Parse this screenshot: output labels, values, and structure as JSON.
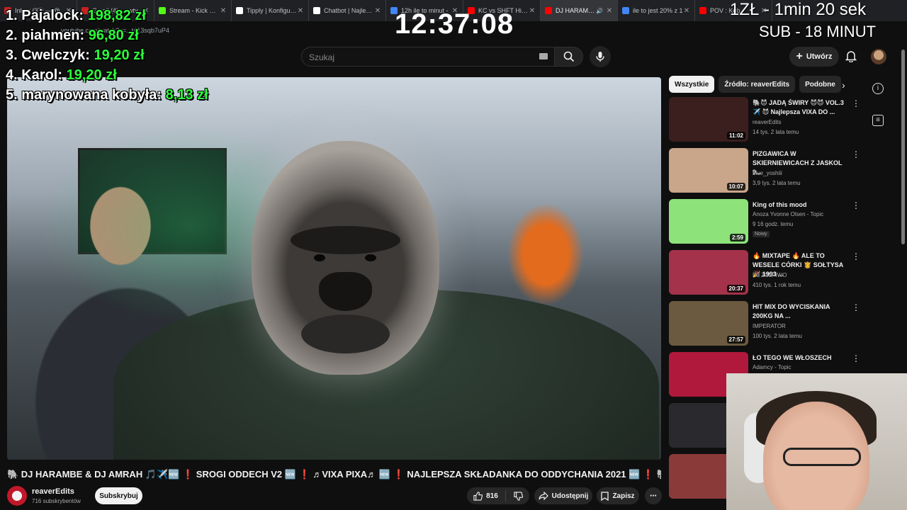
{
  "browser": {
    "tabs": [
      {
        "label": "Inbox (37) — @",
        "color": "#c5221f",
        "active": false
      },
      {
        "label": "Gmail (4) — wtv",
        "color": "#c5221f",
        "active": false
      },
      {
        "label": "Stream - Kick Das",
        "color": "#53fc18",
        "active": false
      },
      {
        "label": "Tipply | Konfigurat",
        "color": "#ffffff",
        "active": false
      },
      {
        "label": "Chatbot | Najlepsz",
        "color": "#ffffff",
        "active": false
      },
      {
        "label": "12h ile to minut -",
        "color": "#4285f4",
        "active": false
      },
      {
        "label": "KC vs SHFT Highli",
        "color": "#ff0000",
        "active": false
      },
      {
        "label": "DJ HARAMBE",
        "color": "#ff0000",
        "active": true
      },
      {
        "label": "ile to jest 20% z 1",
        "color": "#4285f4",
        "active": false
      },
      {
        "label": "POV : Keb",
        "color": "#ff0000",
        "active": false
      }
    ],
    "address": "youtube.com/watch?v=...t413sqb7uP4"
  },
  "overlay": {
    "donors": [
      {
        "name": "1. Pajalock:",
        "amount": "198,82 zł"
      },
      {
        "name": "2. piahmen:",
        "amount": "96,80 zł"
      },
      {
        "name": "3. Cwelczyk:",
        "amount": "19,20 zł"
      },
      {
        "name": "4. Karol:",
        "amount": "19,20 zł"
      },
      {
        "name": "5. marynowana kobyła:",
        "amount": "8,13 zł"
      }
    ],
    "clock": "12:37:08",
    "promo_line1": "1ZŁ - 1min 20 sek",
    "promo_line2": "SUB - 18 MINUT"
  },
  "youtube": {
    "search_placeholder": "Szukaj",
    "create_label": "Utwórz",
    "video": {
      "title": "🐘 DJ HARAMBE & DJ AMRAH 🎵✈️🆕 ❗ SROGI ODDECH V2 🆕 ❗ ♬VIXA PIXA♬ 🆕 ❗ NAJLEPSZA SKŁADANKA DO ODDYCHANIA 2021 🆕 ❗ 🐘",
      "channel": "reaverEdits",
      "subscribers": "716 subskrybentów",
      "subscribe_label": "Subskrybuj",
      "likes": "816",
      "share_label": "Udostępnij",
      "save_label": "Zapisz"
    },
    "chips": [
      "Wszystkie",
      "Źródło: reaverEdits",
      "Podobne"
    ],
    "recommendations": [
      {
        "title": "🐘😈 JADĄ ŚWIRY 😈😈 VOL.3 ✈️ 😈 Najlepsza VIXA DO ...",
        "channel": "reaverEdits",
        "meta": "14 tys.  2 lata temu",
        "duration": "11:02",
        "badge": "",
        "thumb": "#3b1e1e"
      },
      {
        "title": "PIZGAWICA W SKIERNIEWICACH Z JASKOL 9...",
        "channel": "blue_yoshiii",
        "meta": "3,9 tys.  2 lata temu",
        "duration": "10:07",
        "badge": "",
        "thumb": "#c9a58a"
      },
      {
        "title": "King of this mood",
        "channel": "Anoza Yvonne Olsen - Topic",
        "meta": "9  16 godz. temu",
        "duration": "2:59",
        "badge": "Nowy",
        "thumb": "#8de37a"
      },
      {
        "title": "🔥 MIXTAPE 🔥 ALE TO WESELE CÓRKI 👸 SOŁTYSA 🎉 1993 ...",
        "channel": "DJ ZULPIWO",
        "meta": "410 tys.  1 rok temu",
        "duration": "20:37",
        "badge": "",
        "thumb": "#a3324a"
      },
      {
        "title": "HIT MIX DO WYCISKANIA 200KG NA ...",
        "channel": "IMPERATOR",
        "meta": "100 tys.  2 lata temu",
        "duration": "27:57",
        "badge": "",
        "thumb": "#6b5a3f"
      },
      {
        "title": "ŁO TEGO WE WŁOSZECH",
        "channel": "Adamcy - Topic",
        "meta": "",
        "duration": "",
        "badge": "",
        "thumb": "#b0193c"
      },
      {
        "title": "",
        "channel": "",
        "meta": "",
        "duration": "",
        "badge": "",
        "thumb": "#2a2a2e"
      },
      {
        "title": "",
        "channel": "",
        "meta": "",
        "duration": "",
        "badge": "",
        "thumb": "#8b3a3a"
      }
    ]
  }
}
